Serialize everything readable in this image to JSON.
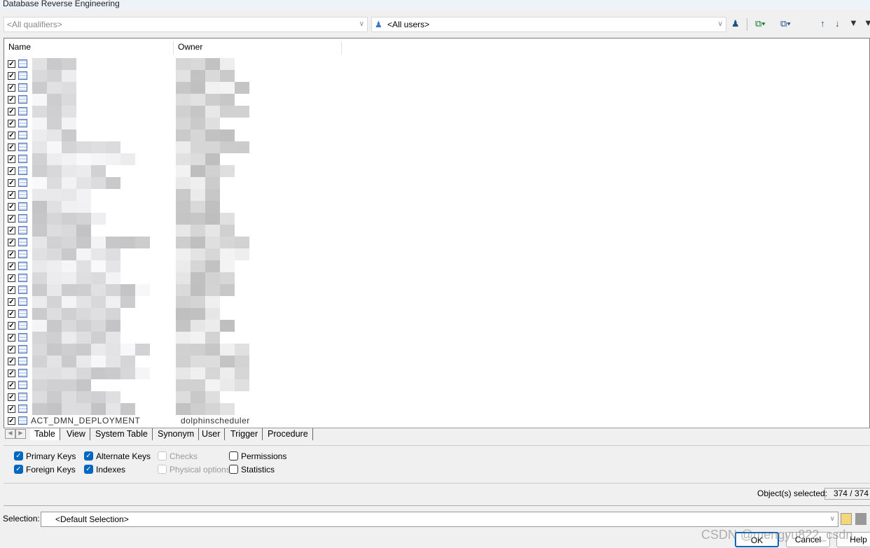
{
  "window": {
    "title": "Database Reverse Engineering"
  },
  "toolbar": {
    "qualifier": "<All qualifiers>",
    "owner": "<All users>",
    "icons": [
      "select-user-icon",
      "select-all-icon",
      "deselect-all-icon",
      "move-up-icon",
      "move-down-icon",
      "filter-edit-icon",
      "filter-icon"
    ]
  },
  "list": {
    "columns": [
      "Name",
      "Owner"
    ],
    "visible_row": {
      "name": "ACT_DMN_DEPLOYMENT",
      "owner": "dolphinscheduler"
    },
    "row_count": 31
  },
  "tabs": [
    "Table",
    "View",
    "System Table",
    "Synonym",
    "User",
    "Trigger",
    "Procedure"
  ],
  "active_tab": "Table",
  "options": [
    {
      "label": "Primary Keys",
      "checked": true,
      "enabled": true
    },
    {
      "label": "Foreign Keys",
      "checked": true,
      "enabled": true
    },
    {
      "label": "Alternate Keys",
      "checked": true,
      "enabled": true
    },
    {
      "label": "Indexes",
      "checked": true,
      "enabled": true
    },
    {
      "label": "Checks",
      "checked": false,
      "enabled": false
    },
    {
      "label": "Physical options",
      "checked": false,
      "enabled": false
    },
    {
      "label": "Permissions",
      "checked": false,
      "enabled": true
    },
    {
      "label": "Statistics",
      "checked": false,
      "enabled": true
    }
  ],
  "status": {
    "label": "Object(s) selected:",
    "value": "374 / 374"
  },
  "selection": {
    "label": "Selection:",
    "value": "<Default Selection>"
  },
  "buttons": {
    "ok": "OK",
    "cancel": "Cancel",
    "help": "Help"
  },
  "watermark": "CSDN @mengyu822_csdn"
}
